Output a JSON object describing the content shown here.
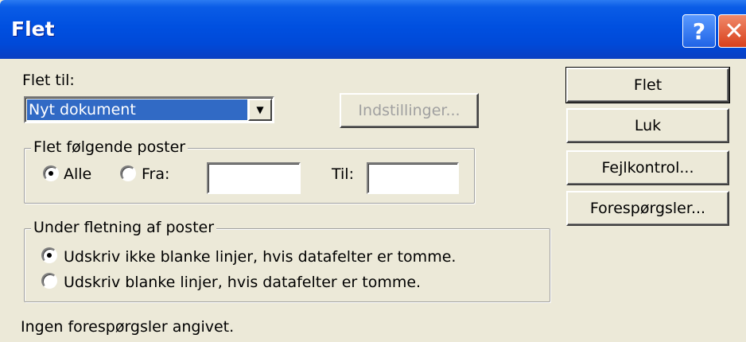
{
  "window": {
    "title": "Flet",
    "help_glyph": "?",
    "close_glyph": "✕"
  },
  "merge_to": {
    "label": "Flet til:",
    "selected": "Nyt dokument",
    "options_button": "Indstillinger..."
  },
  "records": {
    "legend": "Flet følgende poster",
    "all_label": "Alle",
    "from_label": "Fra:",
    "to_label": "Til:",
    "from_value": "",
    "to_value": ""
  },
  "blank_lines": {
    "legend": "Under fletning af poster",
    "option1": "Udskriv ikke blanke linjer, hvis datafelter er tomme.",
    "option2": "Udskriv blanke linjer, hvis datafelter er tomme."
  },
  "status": "Ingen forespørgsler angivet.",
  "buttons": {
    "merge": "Flet",
    "close": "Luk",
    "check_errors": "Fejlkontrol...",
    "query_options": "Forespørgsler..."
  }
}
